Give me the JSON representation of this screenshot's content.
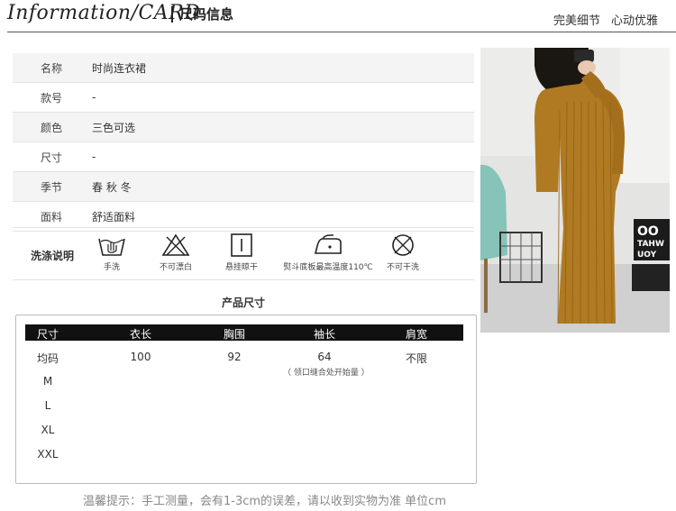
{
  "header": {
    "title_en": "Information/CARD",
    "title_cn": "尺码信息",
    "slogan_1": "完美细节",
    "slogan_2": "心动优雅"
  },
  "info": {
    "rows": [
      {
        "key": "名称",
        "value": "时尚连衣裙"
      },
      {
        "key": "款号",
        "value": "-"
      },
      {
        "key": "颜色",
        "value": "三色可选"
      },
      {
        "key": "尺寸",
        "value": "-"
      },
      {
        "key": "季节",
        "value": "春 秋 冬"
      },
      {
        "key": "面料",
        "value": "舒适面料"
      }
    ],
    "wash_title": "洗涤说明",
    "wash_items": [
      {
        "icon": "hand-wash-icon",
        "label": "手洗"
      },
      {
        "icon": "no-bleach-icon",
        "label": "不可漂白"
      },
      {
        "icon": "hang-dry-icon",
        "label": "悬挂晾干"
      },
      {
        "icon": "iron-icon",
        "label": "熨斗底板最高温度110℃"
      },
      {
        "icon": "no-dry-clean-icon",
        "label": "不可干洗"
      }
    ]
  },
  "size": {
    "title": "产品尺寸",
    "headers": [
      "尺寸",
      "衣长",
      "胸围",
      "袖长",
      "肩宽"
    ],
    "sizes": [
      "均码",
      "M",
      "L",
      "XL",
      "XXL"
    ],
    "length": "100",
    "chest": "92",
    "sleeve": "64",
    "sleeve_note": "（ 领口缝合处开始量 ）",
    "shoulder": "不限"
  },
  "footer": "温馨提示：手工测量，会有1-3cm的误差，请以收到实物为准 单位cm",
  "photo": {
    "sign_text_1": "OO",
    "sign_text_2": "TAHW",
    "sign_text_3": "UOY"
  },
  "colors": {
    "dress": "#b07a22",
    "header_bar": "#111111"
  }
}
